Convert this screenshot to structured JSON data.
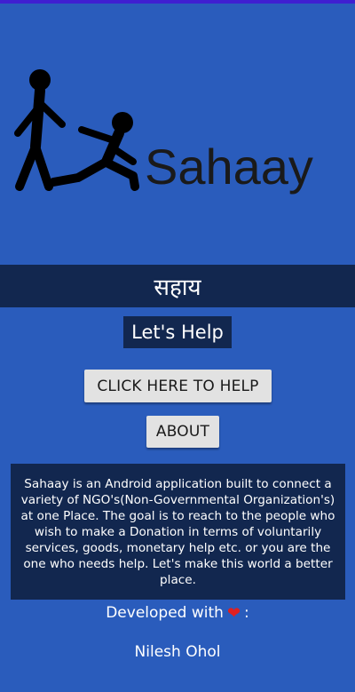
{
  "logo": {
    "text": "Sahaay"
  },
  "hindi_title": "सहाय",
  "tagline": "Let's Help",
  "buttons": {
    "help": "CLICK HERE TO HELP",
    "about": "ABOUT"
  },
  "description": "Sahaay is an Android application built to connect a variety of NGO's(Non-Governmental Organization's) at one Place. The goal is to reach to the people who wish to make a Donation in terms of voluntarily services, goods, monetary help etc. or you are the one who needs help. Let's make this world a better place.",
  "developed": {
    "prefix": "Developed with",
    "suffix": ":"
  },
  "author": "Nilesh Ohol",
  "colors": {
    "background": "#2a5cbc",
    "dark_band": "#12274f",
    "button": "#e2e2e2",
    "heart": "#e02020"
  }
}
